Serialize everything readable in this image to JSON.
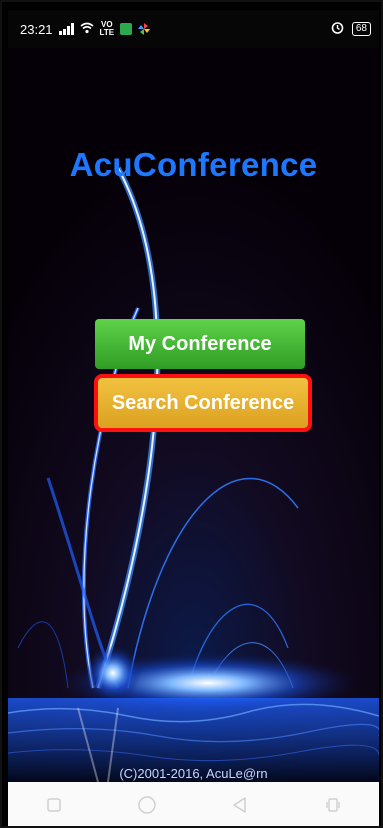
{
  "status_bar": {
    "time": "23:21",
    "volte_top": "VO",
    "volte_bottom": "LTE",
    "battery": "68"
  },
  "app": {
    "title": "AcuConference",
    "buttons": {
      "my_conference": "My Conference",
      "search_conference": "Search Conference"
    },
    "copyright": "(C)2001-2016, AcuLe@rn"
  },
  "nav_bar": {
    "icons": [
      "recent-apps-icon",
      "home-icon",
      "back-icon",
      "rotate-icon"
    ]
  },
  "colors": {
    "title": "#1e78ff",
    "my_conference_button": "#3fb22f",
    "search_conference_button": "#e6b02b",
    "highlight": "#ff1010"
  }
}
